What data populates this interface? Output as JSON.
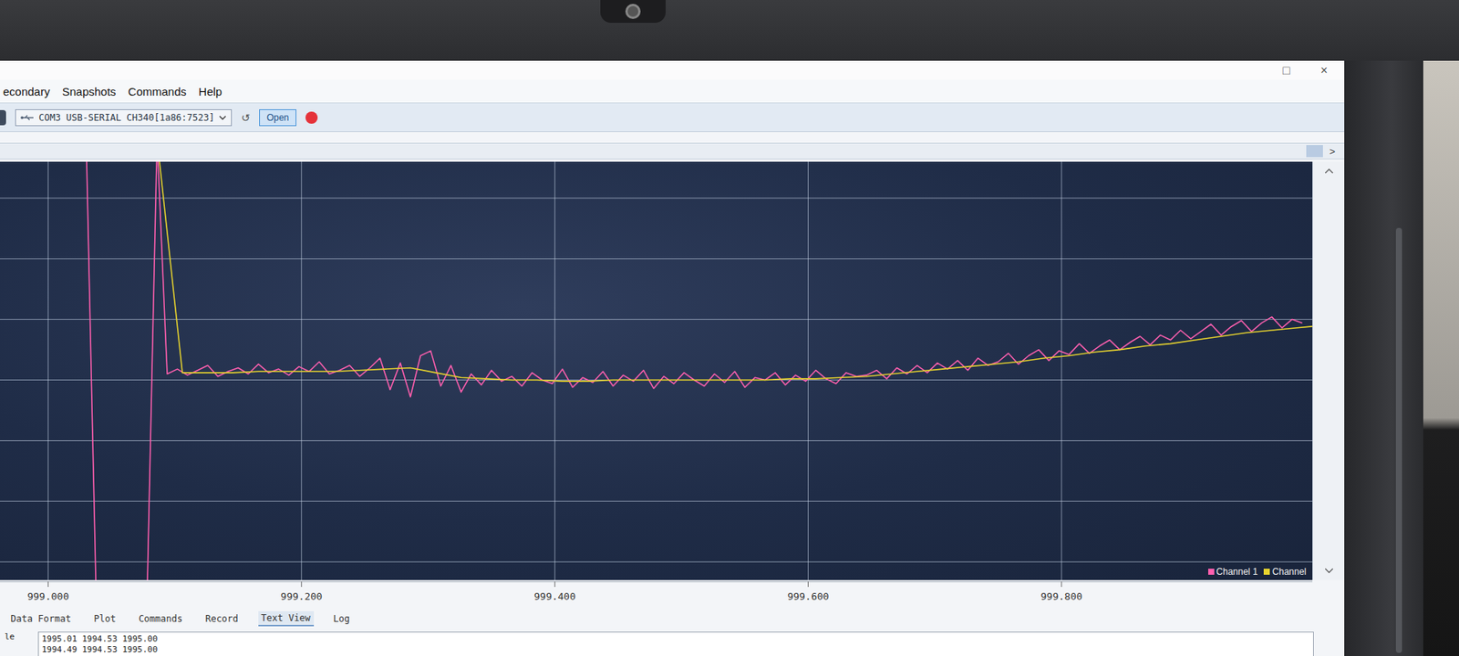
{
  "window": {
    "controls": [
      "□",
      "×"
    ]
  },
  "menu": [
    "econdary",
    "Snapshots",
    "Commands",
    "Help"
  ],
  "toolbar": {
    "port": "COM3 USB-SERIAL CH340[1a86:7523]",
    "refresh": "↺",
    "open_button": "Open"
  },
  "strip": {
    "arrow": ">"
  },
  "chart": {
    "x_range": [
      998.962,
      999.998
    ],
    "y_range": [
      1993.35,
      1996.8
    ],
    "x_ticks": [
      "999.000",
      "999.200",
      "999.400",
      "999.600",
      "999.800"
    ],
    "series": [
      {
        "name": "Channel 1",
        "color": "#ff5fae",
        "x_start": 999.03,
        "x_step": 0.008,
        "values": [
          2400,
          1600,
          1600,
          1600,
          1600,
          1600,
          1600,
          2400,
          1995.05,
          1995.09,
          1995.04,
          1995.08,
          1995.12,
          1995.03,
          1995.07,
          1995.1,
          1995.05,
          1995.13,
          1995.06,
          1995.09,
          1995.04,
          1995.11,
          1995.07,
          1995.15,
          1995.05,
          1995.08,
          1995.12,
          1995.03,
          1995.1,
          1995.18,
          1994.92,
          1995.14,
          1994.86,
          1995.2,
          1995.24,
          1994.95,
          1995.12,
          1994.9,
          1995.05,
          1994.96,
          1995.08,
          1994.99,
          1995.03,
          1994.95,
          1995.06,
          1995.0,
          1994.97,
          1995.09,
          1994.94,
          1995.02,
          1994.98,
          1995.07,
          1994.95,
          1995.04,
          1994.99,
          1995.08,
          1994.93,
          1995.03,
          1994.97,
          1995.06,
          1995.0,
          1994.95,
          1995.05,
          1994.98,
          1995.07,
          1994.94,
          1995.02,
          1995.0,
          1995.06,
          1994.96,
          1995.04,
          1994.99,
          1995.08,
          1995.01,
          1994.97,
          1995.06,
          1995.03,
          1995.04,
          1995.08,
          1995.01,
          1995.1,
          1995.05,
          1995.12,
          1995.06,
          1995.14,
          1995.09,
          1995.16,
          1995.08,
          1995.18,
          1995.12,
          1995.15,
          1995.22,
          1995.13,
          1995.2,
          1995.25,
          1995.16,
          1995.24,
          1995.21,
          1995.3,
          1995.22,
          1995.28,
          1995.33,
          1995.25,
          1995.31,
          1995.36,
          1995.29,
          1995.37,
          1995.33,
          1995.41,
          1995.34,
          1995.4,
          1995.46,
          1995.37,
          1995.44,
          1995.49,
          1995.4,
          1995.47,
          1995.52,
          1995.43,
          1995.5,
          1995.47
        ]
      },
      {
        "name": "Channel",
        "color": "#e6d22e",
        "x_start": 999.086,
        "x_step": 0.02,
        "values": [
          2400,
          1995.06,
          1995.06,
          1995.06,
          1995.07,
          1995.07,
          1995.07,
          1995.07,
          1995.08,
          1995.09,
          1995.1,
          1995.06,
          1995.02,
          1995.01,
          1995.0,
          1995.0,
          1994.99,
          1994.99,
          1995.0,
          1995.0,
          1995.0,
          1995.0,
          1995.0,
          1995.0,
          1995.0,
          1995.01,
          1995.01,
          1995.02,
          1995.03,
          1995.05,
          1995.07,
          1995.09,
          1995.11,
          1995.13,
          1995.15,
          1995.18,
          1995.2,
          1995.23,
          1995.25,
          1995.28,
          1995.3,
          1995.33,
          1995.36,
          1995.39,
          1995.41,
          1995.43,
          1995.45
        ]
      }
    ]
  },
  "bottom_tabs": [
    {
      "label": "Data Format",
      "selected": false
    },
    {
      "label": "Plot",
      "selected": false
    },
    {
      "label": "Commands",
      "selected": false
    },
    {
      "label": "Record",
      "selected": false
    },
    {
      "label": "Text View",
      "selected": true
    },
    {
      "label": "Log",
      "selected": false
    }
  ],
  "text_view": {
    "label": "le",
    "lines": [
      "1995.01 1994.53 1995.00",
      "1994.49 1994.53 1995.00"
    ]
  }
}
